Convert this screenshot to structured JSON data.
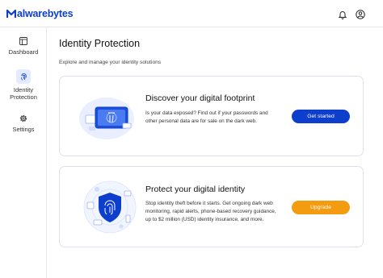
{
  "app": {
    "logo_prefix": "M",
    "logo_text": "alwarebytes"
  },
  "header": {
    "notification_icon": "bell-icon",
    "account_icon": "user-circle-icon"
  },
  "sidebar": {
    "items": [
      {
        "label": "Dashboard",
        "icon": "dashboard-icon",
        "active": false
      },
      {
        "label": "Identity Protection",
        "icon": "fingerprint-icon",
        "active": true
      },
      {
        "label": "Settings",
        "icon": "gear-icon",
        "active": false
      }
    ]
  },
  "main": {
    "title": "Identity Protection",
    "subtitle": "Explore and manage your identity solutions",
    "cards": [
      {
        "title": "Discover your digital footprint",
        "description": "Is your data exposed? Find out if your passwords and other personal data are for sale on the dark web.",
        "button": "Get started",
        "button_color": "#0d3ecc"
      },
      {
        "title": "Protect your digital identity",
        "description": "Stop identity theft before it starts. Get ongoing dark web monitoring, rapid alerts, phone-based recovery guidance, up to $2 million (USD) identity insurance, and more.",
        "button": "Upgrade",
        "button_color": "#f39c12"
      }
    ]
  },
  "colors": {
    "brand": "#0d3ecc",
    "accent": "#f39c12",
    "active_nav_bg": "#e4ebff"
  }
}
